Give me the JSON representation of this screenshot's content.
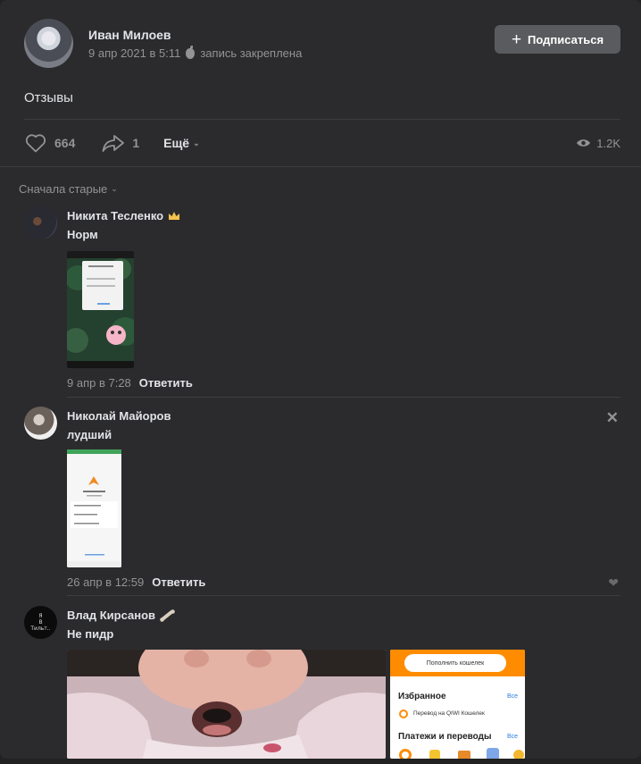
{
  "post": {
    "author": "Иван Милоев",
    "date": "9 апр 2021 в 5:11",
    "pinned": "запись закреплена",
    "subscribe_label": "Подписаться",
    "text": "Отзывы",
    "likes": "664",
    "shares": "1",
    "more_label": "Ещё",
    "views": "1.2K"
  },
  "sort_label": "Сначала старые",
  "comments": [
    {
      "name": "Никита Тесленко",
      "badge": "crown-icon",
      "text": "Норм",
      "date": "9 апр в 7:28",
      "reply": "Ответить"
    },
    {
      "name": "Николай Майоров",
      "text": "лудший",
      "date": "26 апр в 12:59",
      "reply": "Ответить"
    },
    {
      "name": "Влад Кирсанов",
      "badge": "bone-icon",
      "text": "Не пидр",
      "avatar_text": "Я\nВ\nТильт..",
      "qiwi": {
        "button": "Пополнить кошелек",
        "favorites": "Избранное",
        "all1": "Все",
        "transfer": "Перевод на QIWI Кошелек",
        "payments": "Платежи и переводы",
        "all2": "Все"
      }
    }
  ],
  "colors": {
    "background": "#2b2b2d",
    "accent": "#e1e3e6",
    "muted": "#939393",
    "qiwi_orange": "#ff8c00"
  }
}
